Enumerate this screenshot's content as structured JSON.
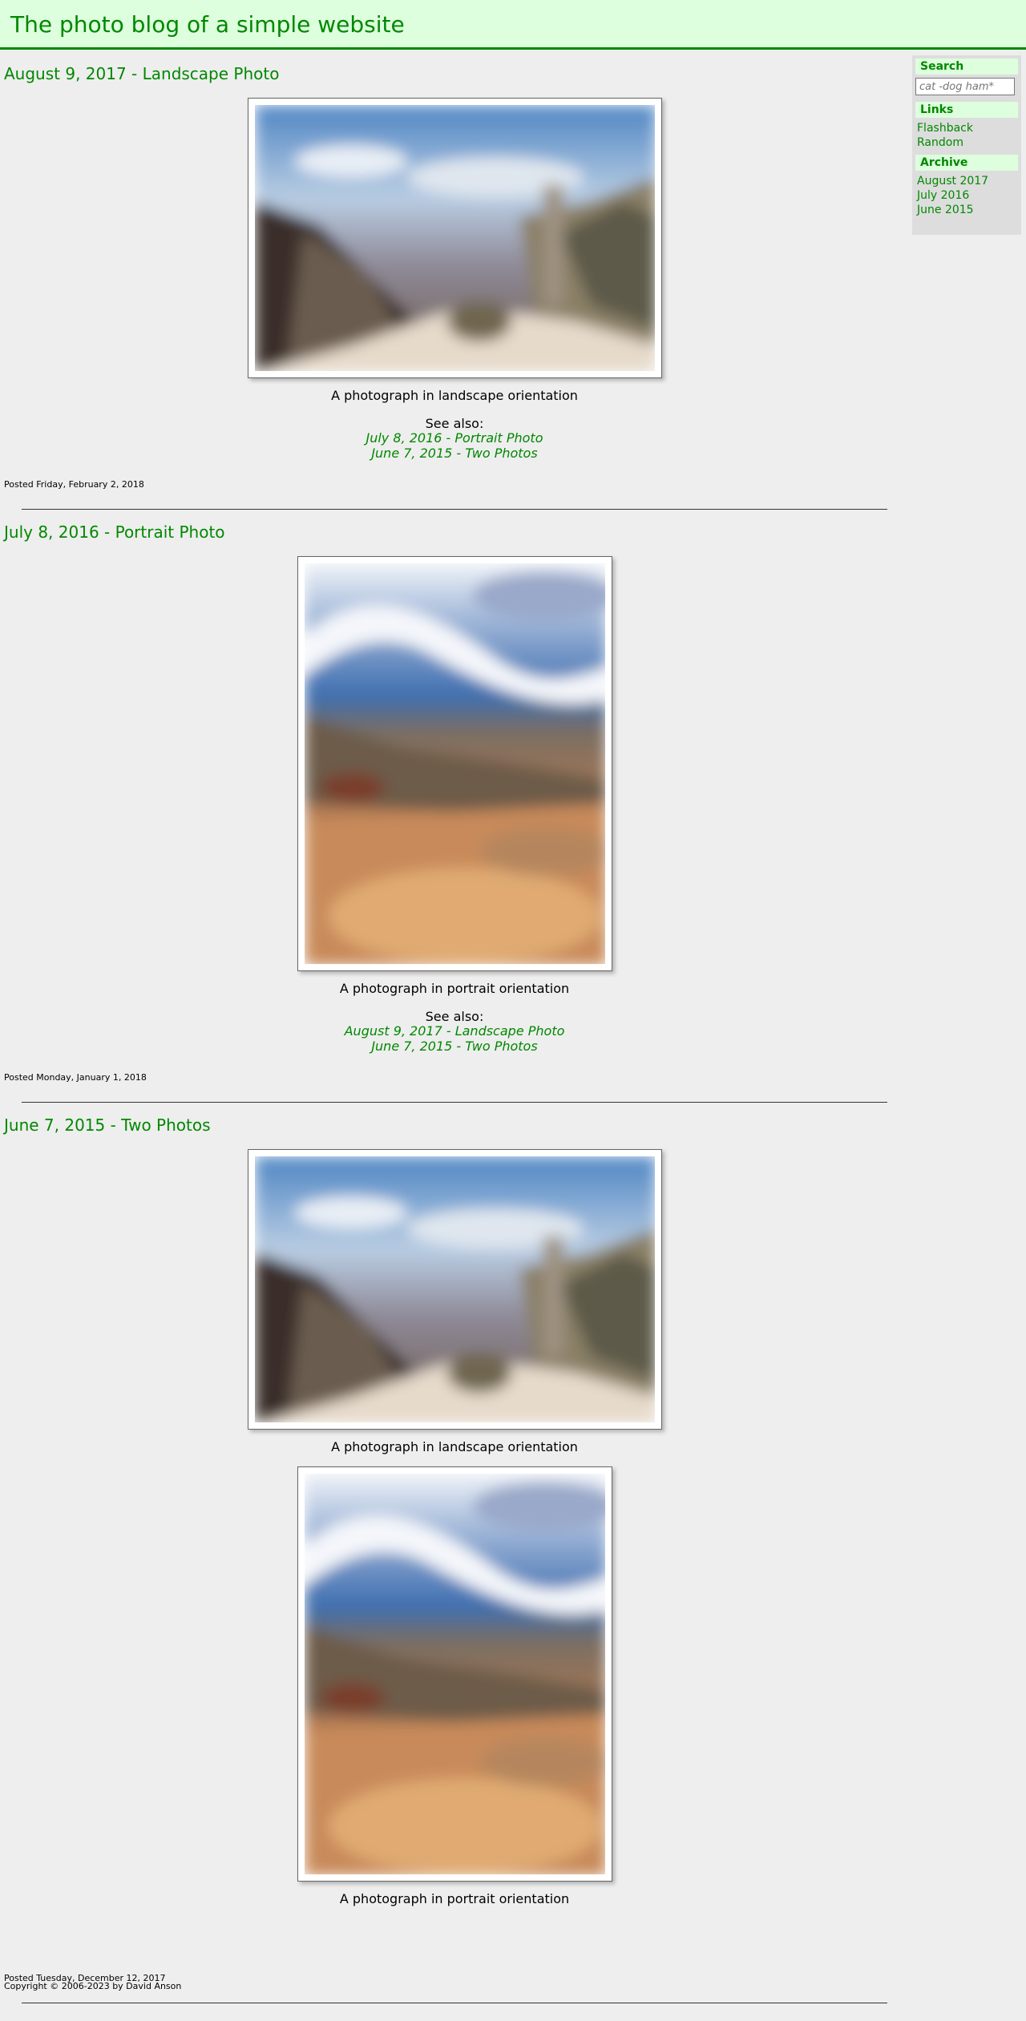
{
  "site": {
    "title": "The photo blog of a simple website"
  },
  "sidebar": {
    "search_heading": "Search",
    "search_placeholder": "cat -dog ham*",
    "links_heading": "Links",
    "links": [
      "Flashback",
      "Random"
    ],
    "archive_heading": "Archive",
    "archive": [
      "August 2017",
      "July 2016",
      "June 2015"
    ]
  },
  "posts": [
    {
      "title": "August 9, 2017 - Landscape Photo",
      "caption": "A photograph in landscape orientation",
      "see_also_label": "See also:",
      "see_also": [
        "July 8, 2016 - Portrait Photo",
        "June 7, 2015 - Two Photos"
      ],
      "posted": "Posted Friday, February 2, 2018"
    },
    {
      "title": "July 8, 2016 - Portrait Photo",
      "caption": "A photograph in portrait orientation",
      "see_also_label": "See also:",
      "see_also": [
        "August 9, 2017 - Landscape Photo",
        "June 7, 2015 - Two Photos"
      ],
      "posted": "Posted Monday, January 1, 2018"
    },
    {
      "title": "June 7, 2015 - Two Photos",
      "captions": [
        "A photograph in landscape orientation",
        "A photograph in portrait orientation"
      ],
      "posted": "Posted Tuesday, December 12, 2017"
    }
  ],
  "footer": {
    "copyright": "Copyright © 2006-2023 by David Anson"
  },
  "colors": {
    "accent": "#008800",
    "header_bg": "#ddffdd",
    "page_bg": "#eeeeee"
  }
}
